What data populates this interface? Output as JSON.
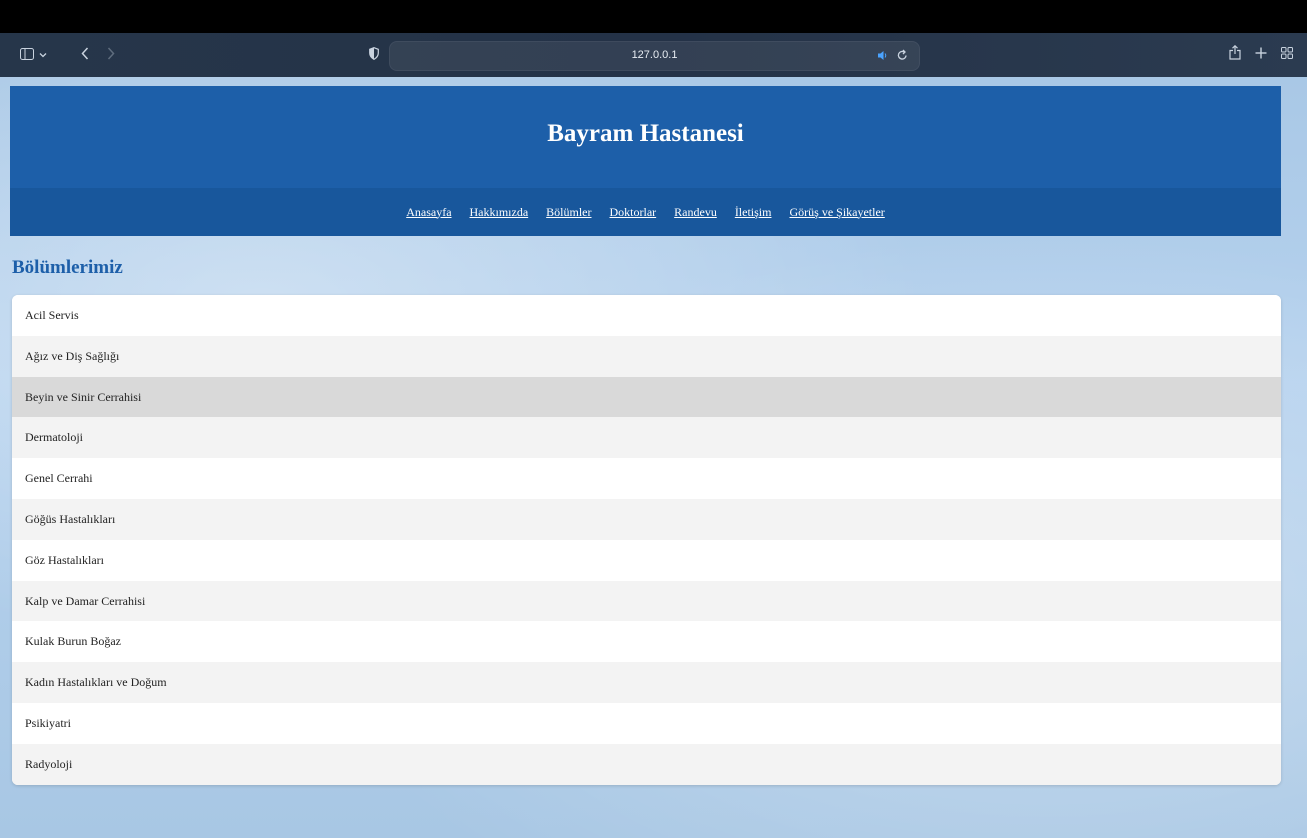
{
  "browser": {
    "url": "127.0.0.1",
    "icons": [
      "sidebar-icon",
      "chevron-down-icon",
      "back-icon",
      "forward-icon",
      "shield-icon",
      "audio-icon",
      "reload-icon",
      "share-icon",
      "new-tab-icon",
      "tab-overview-icon"
    ]
  },
  "header": {
    "title": "Bayram Hastanesi",
    "nav": [
      "Anasayfa",
      "Hakkımızda",
      "Bölümler",
      "Doktorlar",
      "Randevu",
      "İletişim",
      "Görüş ve Şikayetler"
    ]
  },
  "main": {
    "section_title": "Bölümlerimiz",
    "departments": [
      "Acil Servis",
      "Ağız ve Diş Sağlığı",
      "Beyin ve Sinir Cerrahisi",
      "Dermatoloji",
      "Genel Cerrahi",
      "Göğüs Hastalıkları",
      "Göz Hastalıkları",
      "Kalp ve Damar Cerrahisi",
      "Kulak Burun Boğaz",
      "Kadın Hastalıkları ve Doğum",
      "Psikiyatri",
      "Radyoloji"
    ],
    "hovered_index": 2
  },
  "colors": {
    "header_bg": "#1d5fa9",
    "nav_bg": "#18579c",
    "title_color": "#1d5fa9",
    "hover_row": "#d9d9d9"
  }
}
